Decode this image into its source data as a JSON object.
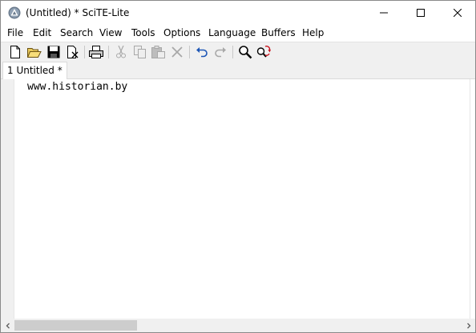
{
  "window": {
    "title": "(Untitled) * SciTE-Lite"
  },
  "menu": {
    "items": [
      "File",
      "Edit",
      "Search",
      "View",
      "Tools",
      "Options",
      "Language",
      "Buffers",
      "Help"
    ]
  },
  "toolbar": {
    "buttons": [
      {
        "name": "new-file-icon",
        "enabled": true
      },
      {
        "name": "open-folder-icon",
        "enabled": true
      },
      {
        "name": "save-icon",
        "enabled": true
      },
      {
        "name": "close-file-icon",
        "enabled": true
      },
      {
        "name": "print-icon",
        "enabled": true
      },
      {
        "name": "cut-icon",
        "enabled": false
      },
      {
        "name": "copy-icon",
        "enabled": false
      },
      {
        "name": "paste-icon",
        "enabled": false
      },
      {
        "name": "delete-icon",
        "enabled": false
      },
      {
        "name": "undo-icon",
        "enabled": true
      },
      {
        "name": "redo-icon",
        "enabled": false
      },
      {
        "name": "find-icon",
        "enabled": true
      },
      {
        "name": "replace-icon",
        "enabled": true
      }
    ]
  },
  "tabs": [
    {
      "label": "1 Untitled *",
      "active": true
    }
  ],
  "editor": {
    "lines": [
      "www.historian.by"
    ]
  },
  "colors": {
    "toolbar_bg": "#f0f0f0",
    "disabled_icon": "#a8a8a8",
    "accent_blue": "#1c55b5"
  }
}
